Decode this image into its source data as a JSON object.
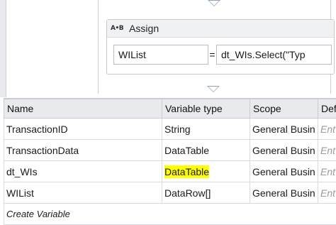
{
  "assign": {
    "icon_label": "A•B",
    "title": "Assign",
    "to_value": "WIList",
    "equals": "=",
    "value_expression": "dt_WIs.Select(\"Typ"
  },
  "variables": {
    "headers": [
      "Name",
      "Variable type",
      "Scope",
      "Def"
    ],
    "rows": [
      {
        "name": "TransactionID",
        "type": "String",
        "scope": "General Busin",
        "default": "Ent"
      },
      {
        "name": "TransactionData",
        "type": "DataTable",
        "scope": "General Busin",
        "default": "Ent"
      },
      {
        "name": "dt_WIs",
        "type": "DataTable",
        "scope": "General Busin",
        "default": "Ent"
      },
      {
        "name": "WIList",
        "type": "DataRow[]",
        "scope": "General Busin",
        "default": "Ent"
      }
    ],
    "create_label": "Create Variable"
  },
  "colors": {
    "highlight": "#ffff00",
    "header_bg": "#e8eaed",
    "arrow": "#8fa3b8"
  }
}
